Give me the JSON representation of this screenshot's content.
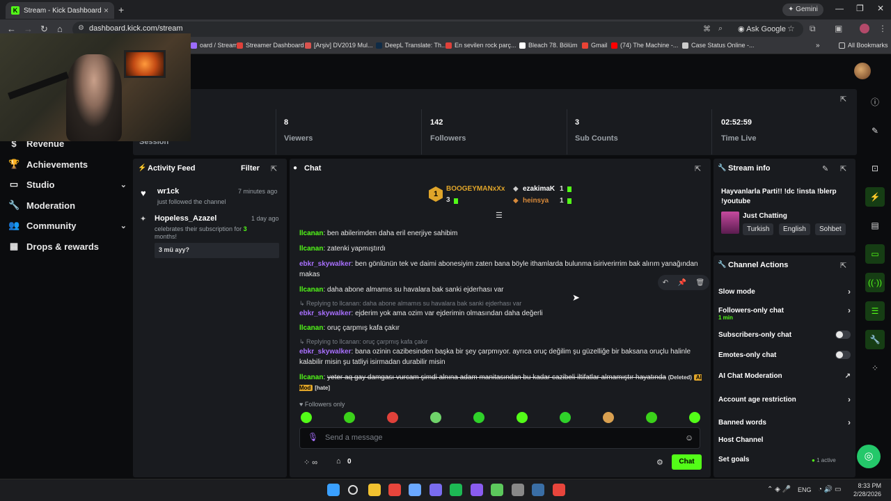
{
  "browser": {
    "tab_title": "Stream - Kick Dashboard",
    "url": "dashboard.kick.com/stream",
    "gemini": "Gemini",
    "ask_google": "Ask Google",
    "bookmarks": [
      {
        "label": "oard / Stream...",
        "color": "#9c6cff"
      },
      {
        "label": "Streamer Dashboard",
        "color": "#e0413a"
      },
      {
        "label": "[Arşiv] DV2019 Mul...",
        "color": "#d9534f"
      },
      {
        "label": "DeepL Translate: Th...",
        "color": "#0f2b46"
      },
      {
        "label": "En sevilen rock parç...",
        "color": "#e0413a"
      },
      {
        "label": "Bleach 78. Bölüm",
        "color": "#ffffff"
      },
      {
        "label": "Gmail",
        "color": "#ea4335"
      },
      {
        "label": "(74) The Machine -...",
        "color": "#ff0000"
      },
      {
        "label": "Case Status Online -...",
        "color": "#cccccc"
      }
    ],
    "all_bookmarks": "All Bookmarks"
  },
  "sidebar": {
    "items": [
      {
        "label": "Revenue",
        "icon": "dollar-icon"
      },
      {
        "label": "Achievements",
        "icon": "trophy-icon"
      },
      {
        "label": "Studio",
        "icon": "studio-icon"
      },
      {
        "label": "Moderation",
        "icon": "wrench-icon"
      },
      {
        "label": "Community",
        "icon": "community-icon"
      },
      {
        "label": "Drops & rewards",
        "icon": "gift-icon"
      }
    ]
  },
  "stats": {
    "session_label": "Session",
    "viewers": {
      "value": "8",
      "label": "Viewers"
    },
    "followers": {
      "value": "142",
      "label": "Followers"
    },
    "subs": {
      "value": "3",
      "label": "Sub Counts"
    },
    "time": {
      "value": "02:52:59",
      "label": "Time Live"
    }
  },
  "activity": {
    "title": "Activity Feed",
    "filter": "Filter",
    "items": [
      {
        "name": "wr1ck",
        "time": "7 minutes ago",
        "text": "just followed the channel"
      },
      {
        "name": "Hopeless_Azazel",
        "time": "1 day ago",
        "text_a": "celebrates their subscription for ",
        "months": "3",
        "text_b": "months!",
        "message": "3 mü ayy?"
      }
    ]
  },
  "chat": {
    "title": "Chat",
    "leaderboard": [
      {
        "badge": "1",
        "name": "BOOGEYMANxXx",
        "count": "3"
      },
      {
        "name": "ezakimaK",
        "count": "1"
      },
      {
        "name": "heinsya",
        "count": "1"
      }
    ],
    "messages": [
      {
        "user": "llcanan",
        "text": "ben abilerimden daha eril enerjiye sahibim"
      },
      {
        "user": "llcanan",
        "text": "zatenki yapmıştırdı"
      },
      {
        "user": "ebkr_skywalker",
        "text": "ben gönlünün tek ve daimi abonesiyim zaten bana böyle ithamlarda bulunma isiriverirrim bak alırım yanağından makas"
      },
      {
        "user": "llcanan",
        "text": "daha abone almamıs su havalara bak sanki ejderhası var"
      },
      {
        "reply": "Replying to llcanan: daha abone almamıs su havalara bak sanki ejderhası var",
        "user": "ebkr_skywalker",
        "text": "ejderim yok ama ozim var ejderimin olmasından daha değerli"
      },
      {
        "user": "llcanan",
        "text": "oruç çarpmış kafa çakır"
      },
      {
        "reply": "Replying to llcanan: oruç çarpmış kafa çakır",
        "user": "ebkr_skywalker",
        "text": "bana ozinin cazibesinden başka bir şey çarpmıyor. ayrıca oruç değilim şu güzelliğe bir baksana oruçlu halinle kalabilir misin şu tatliyi isirmadan durabilir misin"
      },
      {
        "user": "llcanan",
        "text": "yeter aq gay damgası vurcam şimdi alnına adam manitasından bu kadar cazibeli iltifatlar almamıştır hayatında",
        "deleted": "(Deleted)",
        "ai_mod": "AI Mod",
        "hate": "[hate]"
      }
    ],
    "followers_only": "Followers only",
    "placeholder": "Send a message",
    "points": "0",
    "send_label": "Chat"
  },
  "stream_info": {
    "title": "Stream info",
    "stream_title": "Hayvanlarla Parti!! !dc !insta !blerp !youtube",
    "category": "Just Chatting",
    "tags": [
      "Turkish",
      "English",
      "Sohbet"
    ]
  },
  "channel_actions": {
    "title": "Channel Actions",
    "slow_mode": "Slow mode",
    "followers_only": "Followers-only chat",
    "followers_only_sub": "1 min",
    "subs_only": "Subscribers-only chat",
    "emotes_only": "Emotes-only chat",
    "ai_mod": "AI Chat Moderation",
    "account_age": "Account age restriction",
    "banned_words": "Banned words",
    "host_channel": "Host Channel",
    "set_goals": "Set goals",
    "goals_status": "1 active"
  },
  "taskbar": {
    "lang": "ENG",
    "time": "8:33 PM",
    "date": "2/28/2026"
  },
  "colors": {
    "kick_green": "#53fc18",
    "user_green": "#53fc18",
    "user_purple": "#a970ff",
    "panel": "#191b1f"
  }
}
